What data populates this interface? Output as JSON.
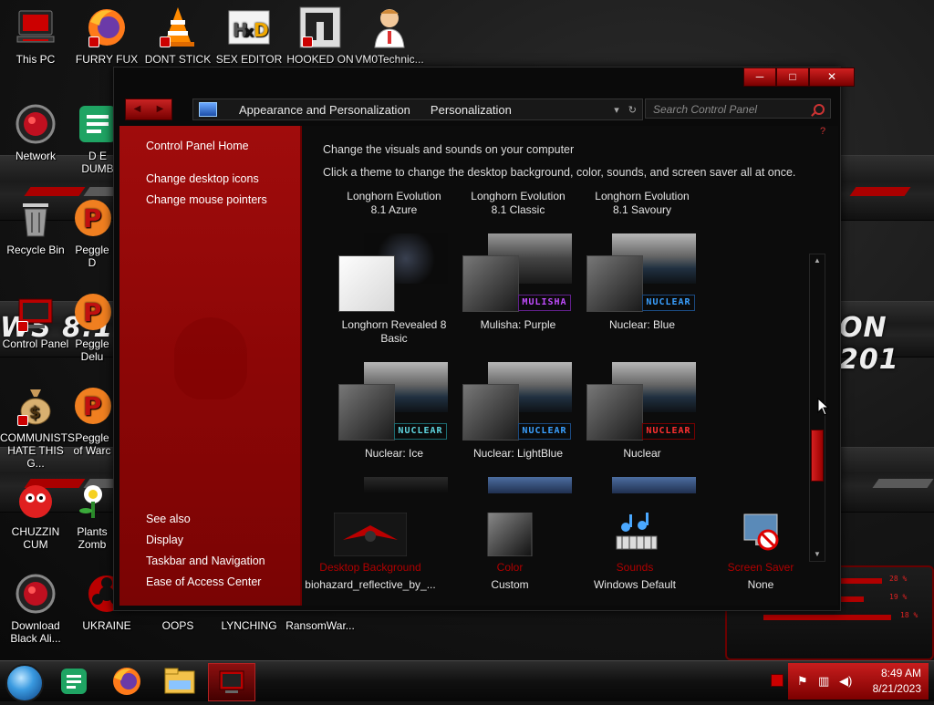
{
  "desktop": {
    "icons": [
      {
        "label": "This PC",
        "icon": "computer-icon"
      },
      {
        "label": "FURRY FUX",
        "icon": "firefox-icon"
      },
      {
        "label": "DONT STICK",
        "icon": "vlc-cone-icon"
      },
      {
        "label": "SEX EDITOR",
        "icon": "hxd-editor-icon"
      },
      {
        "label": "HOOKED ON",
        "icon": "app-icon"
      },
      {
        "label": "VM0Technic...",
        "icon": "doctor-icon"
      },
      {
        "label": "Network",
        "icon": "network-icon"
      },
      {
        "label": "D E\nDUMB",
        "icon": "chat-icon"
      },
      {
        "label": "Recycle Bin",
        "icon": "recycle-bin-icon"
      },
      {
        "label": "Peggle D",
        "icon": "peggle-icon"
      },
      {
        "label": "Control Panel",
        "icon": "control-panel-icon"
      },
      {
        "label": "Peggle\nDelu",
        "icon": "peggle-icon"
      },
      {
        "label": "COMMUNISTS\nHATE THIS G...",
        "icon": "money-bag-icon"
      },
      {
        "label": "Peggle\nof Warc",
        "icon": "peggle-icon"
      },
      {
        "label": "CHUZZIN\nCUM",
        "icon": "chuzzle-icon"
      },
      {
        "label": "Plants\nZomb",
        "icon": "plants-icon"
      },
      {
        "label": "Download\nBlack Ali...",
        "icon": "download-icon"
      },
      {
        "label": "UKRAINE",
        "icon": "biohazard-icon"
      },
      {
        "label": "OOPS",
        "icon": "blank-icon"
      },
      {
        "label": "LYNCHING",
        "icon": "blank-icon"
      },
      {
        "label": "RansomWar...",
        "icon": "blank-icon"
      }
    ],
    "wallpaper_text_left": "WS 8.1",
    "wallpaper_text_right": "ON 201"
  },
  "window": {
    "caption_minimize": "─",
    "caption_maximize": "□",
    "caption_close": "✕",
    "breadcrumb": [
      "Appearance and Personalization",
      "Personalization"
    ],
    "search_placeholder": "Search Control Panel",
    "left_links": {
      "home": "Control Panel Home",
      "desktop_icons": "Change desktop icons",
      "mouse_pointers": "Change mouse pointers"
    },
    "see_also": {
      "heading": "See also",
      "links": [
        "Display",
        "Taskbar and Navigation",
        "Ease of Access Center"
      ]
    },
    "main": {
      "title": "Change the visuals and sounds on your computer",
      "description": "Click a theme to change the desktop background, color, sounds, and screen saver all at once."
    },
    "themes_header": [
      {
        "line1": "Longhorn Evolution",
        "line2": "8.1 Azure"
      },
      {
        "line1": "Longhorn Evolution",
        "line2": "8.1 Classic"
      },
      {
        "line1": "Longhorn Evolution",
        "line2": "8.1 Savoury"
      }
    ],
    "themes_row1": [
      {
        "name_line1": "Longhorn Revealed 8",
        "name_line2": "Basic",
        "badge": ""
      },
      {
        "name_line1": "Mulisha: Purple",
        "name_line2": "",
        "badge": "MULISHA"
      },
      {
        "name_line1": "Nuclear: Blue",
        "name_line2": "",
        "badge": "NUCLEAR"
      }
    ],
    "themes_row2": [
      {
        "name_line1": "Nuclear: Ice",
        "name_line2": "",
        "badge": "NUCLEAR"
      },
      {
        "name_line1": "Nuclear: LightBlue",
        "name_line2": "",
        "badge": "NUCLEAR"
      },
      {
        "name_line1": "Nuclear",
        "name_line2": "",
        "badge": "NUCLEAR"
      }
    ],
    "settings": [
      {
        "label": "Desktop Background",
        "value": "biohazard_reflective_by_...",
        "icon": "wallpaper-thumb-icon"
      },
      {
        "label": "Color",
        "value": "Custom",
        "icon": "color-swatch-icon"
      },
      {
        "label": "Sounds",
        "value": "Windows Default",
        "icon": "sounds-icon"
      },
      {
        "label": "Screen Saver",
        "value": "None",
        "icon": "screen-saver-icon"
      }
    ]
  },
  "taskbar": {
    "clock_time": "8:49 AM",
    "clock_date": "8/21/2023"
  },
  "colors": {
    "accent_red": "#b00000",
    "pane_red": "#9a0a0a",
    "window_bg": "#0a0a0a"
  }
}
